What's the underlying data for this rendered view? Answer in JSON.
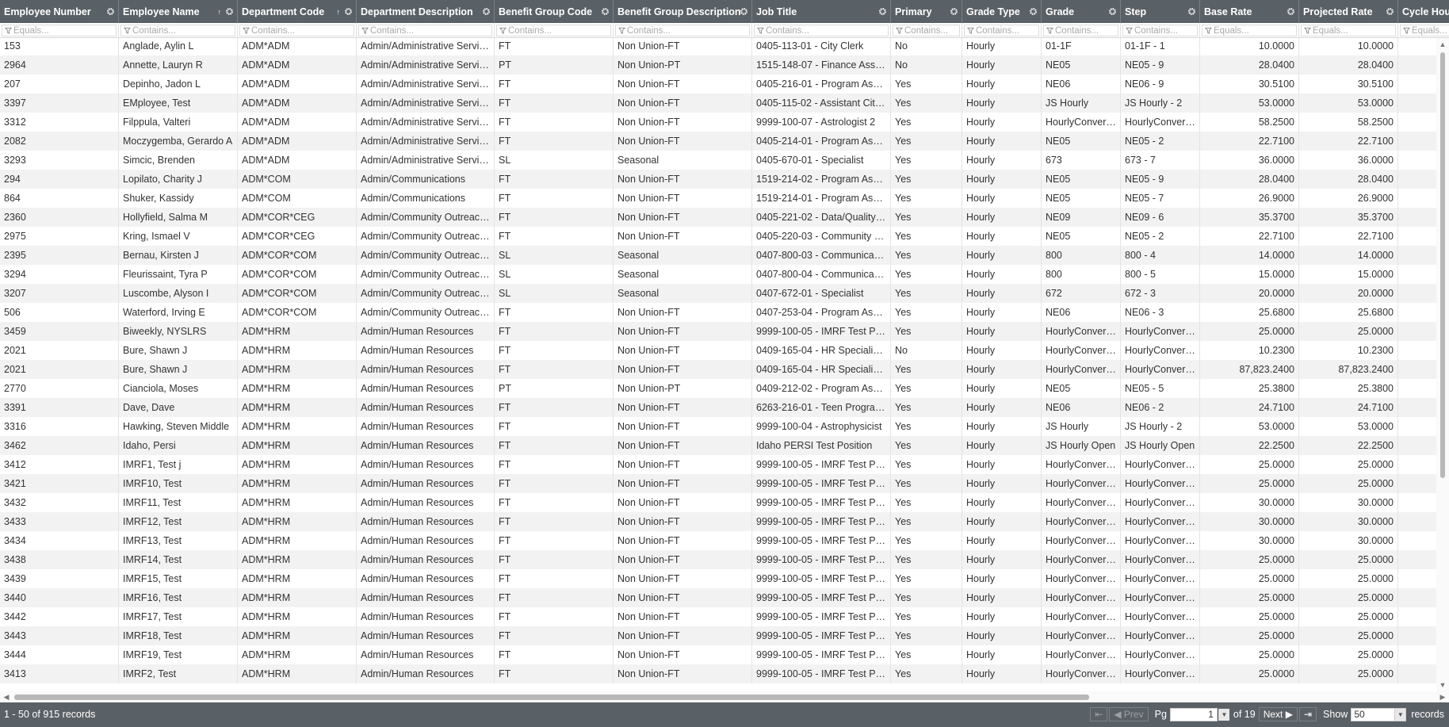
{
  "columns": [
    {
      "key": "emp_no",
      "label": "Employee Number",
      "filter": "Equals...",
      "sort": ""
    },
    {
      "key": "emp_name",
      "label": "Employee Name",
      "filter": "Contains...",
      "sort": "↑"
    },
    {
      "key": "dept_code",
      "label": "Department Code",
      "filter": "Contains...",
      "sort": "↑"
    },
    {
      "key": "dept_desc",
      "label": "Department Description",
      "filter": "Contains...",
      "sort": ""
    },
    {
      "key": "bg_code",
      "label": "Benefit Group Code",
      "filter": "Contains...",
      "sort": ""
    },
    {
      "key": "bg_desc",
      "label": "Benefit Group Description",
      "filter": "Contains...",
      "sort": ""
    },
    {
      "key": "job_title",
      "label": "Job Title",
      "filter": "Contains...",
      "sort": ""
    },
    {
      "key": "primary",
      "label": "Primary",
      "filter": "Contains...",
      "sort": ""
    },
    {
      "key": "grade_type",
      "label": "Grade Type",
      "filter": "Contains...",
      "sort": ""
    },
    {
      "key": "grade",
      "label": "Grade",
      "filter": "Contains...",
      "sort": ""
    },
    {
      "key": "step",
      "label": "Step",
      "filter": "Contains...",
      "sort": ""
    },
    {
      "key": "base_rate",
      "label": "Base Rate",
      "filter": "Equals...",
      "sort": ""
    },
    {
      "key": "proj_rate",
      "label": "Projected Rate",
      "filter": "Equals...",
      "sort": ""
    },
    {
      "key": "cycle_hours",
      "label": "Cycle Hours",
      "filter": "Equals...",
      "sort": ""
    }
  ],
  "rows": [
    [
      "153",
      "Anglade, Aylin L",
      "ADM*ADM",
      "Admin/Administrative Services",
      "FT",
      "Non Union-FT",
      "0405-113-01 - City Clerk",
      "No",
      "Hourly",
      "01-1F",
      "01-1F - 1",
      "10.0000",
      "10.0000",
      ""
    ],
    [
      "2964",
      "Annette, Lauryn R",
      "ADM*ADM",
      "Admin/Administrative Services",
      "PT",
      "Non Union-PT",
      "1515-148-07 - Finance Assist...",
      "No",
      "Hourly",
      "NE05",
      "NE05 - 9",
      "28.0400",
      "28.0400",
      ""
    ],
    [
      "207",
      "Depinho, Jadon L",
      "ADM*ADM",
      "Admin/Administrative Services",
      "FT",
      "Non Union-FT",
      "0405-216-01 - Program Assis...",
      "Yes",
      "Hourly",
      "NE06",
      "NE06 - 9",
      "30.5100",
      "30.5100",
      ""
    ],
    [
      "3397",
      "EMployee, Test",
      "ADM*ADM",
      "Admin/Administrative Services",
      "FT",
      "Non Union-FT",
      "0405-115-02 - Assistant City ...",
      "Yes",
      "Hourly",
      "JS Hourly",
      "JS Hourly - 2",
      "53.0000",
      "53.0000",
      ""
    ],
    [
      "3312",
      "Filppula, Valteri",
      "ADM*ADM",
      "Admin/Administrative Services",
      "FT",
      "Non Union-FT",
      "9999-100-07 - Astrologist 2",
      "Yes",
      "Hourly",
      "HourlyConversi...",
      "HourlyConversi...",
      "58.2500",
      "58.2500",
      ""
    ],
    [
      "2082",
      "Moczygemba, Gerardo A",
      "ADM*ADM",
      "Admin/Administrative Services",
      "FT",
      "Non Union-FT",
      "0405-214-01 - Program Assis...",
      "Yes",
      "Hourly",
      "NE05",
      "NE05 - 2",
      "22.7100",
      "22.7100",
      ""
    ],
    [
      "3293",
      "Simcic, Brenden",
      "ADM*ADM",
      "Admin/Administrative Services",
      "SL",
      "Seasonal",
      "0405-670-01 - Specialist",
      "Yes",
      "Hourly",
      "673",
      "673 - 7",
      "36.0000",
      "36.0000",
      ""
    ],
    [
      "294",
      "Lopilato, Charity J",
      "ADM*COM",
      "Admin/Communications",
      "FT",
      "Non Union-FT",
      "1519-214-02 - Program Assis...",
      "Yes",
      "Hourly",
      "NE05",
      "NE05 - 9",
      "28.0400",
      "28.0400",
      ""
    ],
    [
      "864",
      "Shuker, Kassidy",
      "ADM*COM",
      "Admin/Communications",
      "FT",
      "Non Union-FT",
      "1519-214-01 - Program Assis...",
      "Yes",
      "Hourly",
      "NE05",
      "NE05 - 7",
      "26.9000",
      "26.9000",
      ""
    ],
    [
      "2360",
      "Hollyfield, Salma M",
      "ADM*COR*CEG",
      "Admin/Community Outreach...",
      "FT",
      "Non Union-FT",
      "0405-221-02 - Data/Quality C...",
      "Yes",
      "Hourly",
      "NE09",
      "NE09 - 6",
      "35.3700",
      "35.3700",
      ""
    ],
    [
      "2975",
      "Kring, Ismael V",
      "ADM*COR*CEG",
      "Admin/Community Outreach...",
      "FT",
      "Non Union-FT",
      "0405-220-03 - Community Li...",
      "Yes",
      "Hourly",
      "NE05",
      "NE05 - 2",
      "22.7100",
      "22.7100",
      ""
    ],
    [
      "2395",
      "Bernau, Kirsten J",
      "ADM*COR*COM",
      "Admin/Community Outreach...",
      "SL",
      "Seasonal",
      "0407-800-03 - Communicatio...",
      "Yes",
      "Hourly",
      "800",
      "800 - 4",
      "14.0000",
      "14.0000",
      ""
    ],
    [
      "3294",
      "Fleurissaint, Tyra P",
      "ADM*COR*COM",
      "Admin/Community Outreach...",
      "SL",
      "Seasonal",
      "0407-800-04 - Communicatio...",
      "Yes",
      "Hourly",
      "800",
      "800 - 5",
      "15.0000",
      "15.0000",
      ""
    ],
    [
      "3207",
      "Luscombe, Alyson I",
      "ADM*COR*COM",
      "Admin/Community Outreach...",
      "SL",
      "Seasonal",
      "0407-672-01 - Specialist",
      "Yes",
      "Hourly",
      "672",
      "672 - 3",
      "20.0000",
      "20.0000",
      ""
    ],
    [
      "506",
      "Waterford, Irving E",
      "ADM*COR*COM",
      "Admin/Community Outreach...",
      "FT",
      "Non Union-FT",
      "0407-253-04 - Program Assis...",
      "Yes",
      "Hourly",
      "NE06",
      "NE06 - 3",
      "25.6800",
      "25.6800",
      ""
    ],
    [
      "3459",
      "Biweekly, NYSLRS",
      "ADM*HRM",
      "Admin/Human Resources",
      "FT",
      "Non Union-FT",
      "9999-100-05 - IMRF Test Posi...",
      "Yes",
      "Hourly",
      "HourlyConversi...",
      "HourlyConversi...",
      "25.0000",
      "25.0000",
      ""
    ],
    [
      "2021",
      "Bure, Shawn J",
      "ADM*HRM",
      "Admin/Human Resources",
      "FT",
      "Non Union-FT",
      "0409-165-04 - HR Specialist-...",
      "No",
      "Hourly",
      "HourlyConversi...",
      "HourlyConversi...",
      "10.2300",
      "10.2300",
      ""
    ],
    [
      "2021",
      "Bure, Shawn J",
      "ADM*HRM",
      "Admin/Human Resources",
      "FT",
      "Non Union-FT",
      "0409-165-04 - HR Specialist-...",
      "Yes",
      "Hourly",
      "HourlyConversi...",
      "HourlyConversi...",
      "87,823.2400",
      "87,823.2400",
      ""
    ],
    [
      "2770",
      "Cianciola, Moses",
      "ADM*HRM",
      "Admin/Human Resources",
      "PT",
      "Non Union-PT",
      "0409-212-02 - Program Assis...",
      "Yes",
      "Hourly",
      "NE05",
      "NE05 - 5",
      "25.3800",
      "25.3800",
      ""
    ],
    [
      "3391",
      "Dave, Dave",
      "ADM*HRM",
      "Admin/Human Resources",
      "FT",
      "Non Union-FT",
      "6263-216-01 - Teen Program ...",
      "Yes",
      "Hourly",
      "NE06",
      "NE06 - 2",
      "24.7100",
      "24.7100",
      ""
    ],
    [
      "3316",
      "Hawking, Steven Middle",
      "ADM*HRM",
      "Admin/Human Resources",
      "FT",
      "Non Union-FT",
      "9999-100-04 - Astrophysicist",
      "Yes",
      "Hourly",
      "JS Hourly",
      "JS Hourly - 2",
      "53.0000",
      "53.0000",
      ""
    ],
    [
      "3462",
      "Idaho, Persi",
      "ADM*HRM",
      "Admin/Human Resources",
      "FT",
      "Non Union-FT",
      "Idaho PERSI Test Position",
      "Yes",
      "Hourly",
      "JS Hourly Open",
      "JS Hourly Open",
      "22.2500",
      "22.2500",
      ""
    ],
    [
      "3412",
      "IMRF1, Test j",
      "ADM*HRM",
      "Admin/Human Resources",
      "FT",
      "Non Union-FT",
      "9999-100-05 - IMRF Test Posi...",
      "Yes",
      "Hourly",
      "HourlyConversi...",
      "HourlyConversi...",
      "25.0000",
      "25.0000",
      ""
    ],
    [
      "3421",
      "IMRF10, Test",
      "ADM*HRM",
      "Admin/Human Resources",
      "FT",
      "Non Union-FT",
      "9999-100-05 - IMRF Test Posi...",
      "Yes",
      "Hourly",
      "HourlyConversi...",
      "HourlyConversi...",
      "25.0000",
      "25.0000",
      ""
    ],
    [
      "3432",
      "IMRF11, Test",
      "ADM*HRM",
      "Admin/Human Resources",
      "FT",
      "Non Union-FT",
      "9999-100-05 - IMRF Test Posi...",
      "Yes",
      "Hourly",
      "HourlyConversi...",
      "HourlyConversi...",
      "30.0000",
      "30.0000",
      ""
    ],
    [
      "3433",
      "IMRF12, Test",
      "ADM*HRM",
      "Admin/Human Resources",
      "FT",
      "Non Union-FT",
      "9999-100-05 - IMRF Test Posi...",
      "Yes",
      "Hourly",
      "HourlyConversi...",
      "HourlyConversi...",
      "30.0000",
      "30.0000",
      ""
    ],
    [
      "3434",
      "IMRF13, Test",
      "ADM*HRM",
      "Admin/Human Resources",
      "FT",
      "Non Union-FT",
      "9999-100-05 - IMRF Test Posi...",
      "Yes",
      "Hourly",
      "HourlyConversi...",
      "HourlyConversi...",
      "30.0000",
      "30.0000",
      ""
    ],
    [
      "3438",
      "IMRF14, Test",
      "ADM*HRM",
      "Admin/Human Resources",
      "FT",
      "Non Union-FT",
      "9999-100-05 - IMRF Test Posi...",
      "Yes",
      "Hourly",
      "HourlyConversi...",
      "HourlyConversi...",
      "25.0000",
      "25.0000",
      ""
    ],
    [
      "3439",
      "IMRF15, Test",
      "ADM*HRM",
      "Admin/Human Resources",
      "FT",
      "Non Union-FT",
      "9999-100-05 - IMRF Test Posi...",
      "Yes",
      "Hourly",
      "HourlyConversi...",
      "HourlyConversi...",
      "25.0000",
      "25.0000",
      ""
    ],
    [
      "3440",
      "IMRF16, Test",
      "ADM*HRM",
      "Admin/Human Resources",
      "FT",
      "Non Union-FT",
      "9999-100-05 - IMRF Test Posi...",
      "Yes",
      "Hourly",
      "HourlyConversi...",
      "HourlyConversi...",
      "25.0000",
      "25.0000",
      ""
    ],
    [
      "3442",
      "IMRF17, Test",
      "ADM*HRM",
      "Admin/Human Resources",
      "FT",
      "Non Union-FT",
      "9999-100-05 - IMRF Test Posi...",
      "Yes",
      "Hourly",
      "HourlyConversi...",
      "HourlyConversi...",
      "25.0000",
      "25.0000",
      ""
    ],
    [
      "3443",
      "IMRF18, Test",
      "ADM*HRM",
      "Admin/Human Resources",
      "FT",
      "Non Union-FT",
      "9999-100-05 - IMRF Test Posi...",
      "Yes",
      "Hourly",
      "HourlyConversi...",
      "HourlyConversi...",
      "25.0000",
      "25.0000",
      ""
    ],
    [
      "3444",
      "IMRF19, Test",
      "ADM*HRM",
      "Admin/Human Resources",
      "FT",
      "Non Union-FT",
      "9999-100-05 - IMRF Test Posi...",
      "Yes",
      "Hourly",
      "HourlyConversi...",
      "HourlyConversi...",
      "25.0000",
      "25.0000",
      ""
    ],
    [
      "3413",
      "IMRF2, Test",
      "ADM*HRM",
      "Admin/Human Resources",
      "FT",
      "Non Union-FT",
      "9999-100-05 - IMRF Test Posi...",
      "Yes",
      "Hourly",
      "HourlyConversi...",
      "HourlyConversi...",
      "25.0000",
      "25.0000",
      ""
    ]
  ],
  "footer": {
    "records_text": "1 - 50 of 915 records",
    "prev_label": "Prev",
    "next_label": "Next",
    "page_label": "Pg",
    "page_value": "1",
    "of_label": "of 19",
    "show_label": "Show",
    "show_value": "50",
    "records_label": "records"
  },
  "colors": {
    "header_bg": "#5a6166",
    "footer_bg": "#5a6166",
    "alt_row_bg": "#f2f2f2"
  },
  "icons": {
    "column_menu": "gear-icon",
    "filter": "filter-icon",
    "first_page": "first-page-icon",
    "prev_page": "prev-page-icon",
    "next_page": "next-page-icon",
    "last_page": "last-page-icon"
  }
}
